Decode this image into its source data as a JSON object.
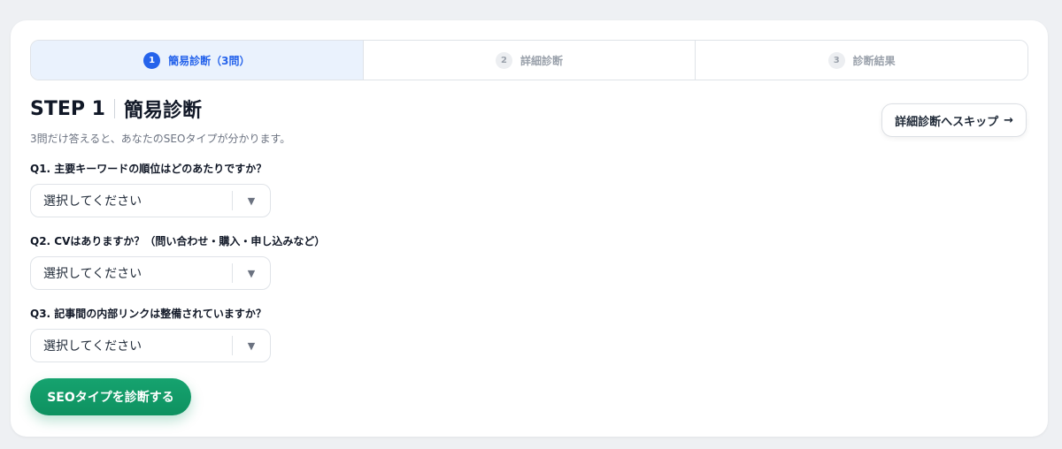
{
  "stepper": {
    "steps": [
      {
        "num": "1",
        "label": "簡易診断（3問）"
      },
      {
        "num": "2",
        "label": "詳細診断"
      },
      {
        "num": "3",
        "label": "診断結果"
      }
    ]
  },
  "header": {
    "step_label": "STEP 1",
    "title": "簡易診断",
    "subtitle": "3問だけ答えると、あなたのSEOタイプが分かります。",
    "skip_label": "詳細診断へスキップ",
    "skip_arrow": "→"
  },
  "questions": [
    {
      "label": "Q1. 主要キーワードの順位はどのあたりですか？",
      "selected": "選択してください"
    },
    {
      "label": "Q2. CVはありますか？（問い合わせ・購入・申し込みなど）",
      "selected": "選択してください"
    },
    {
      "label": "Q3. 記事間の内部リンクは整備されていますか？",
      "selected": "選択してください"
    }
  ],
  "submit_label": "SEOタイプを診断する",
  "icons": {
    "caret": "caret-down-icon",
    "arrow": "arrow-right-icon"
  },
  "colors": {
    "accent": "#2563eb",
    "primary_button": "#0e9160",
    "active_step_bg": "#eaf2fd"
  }
}
